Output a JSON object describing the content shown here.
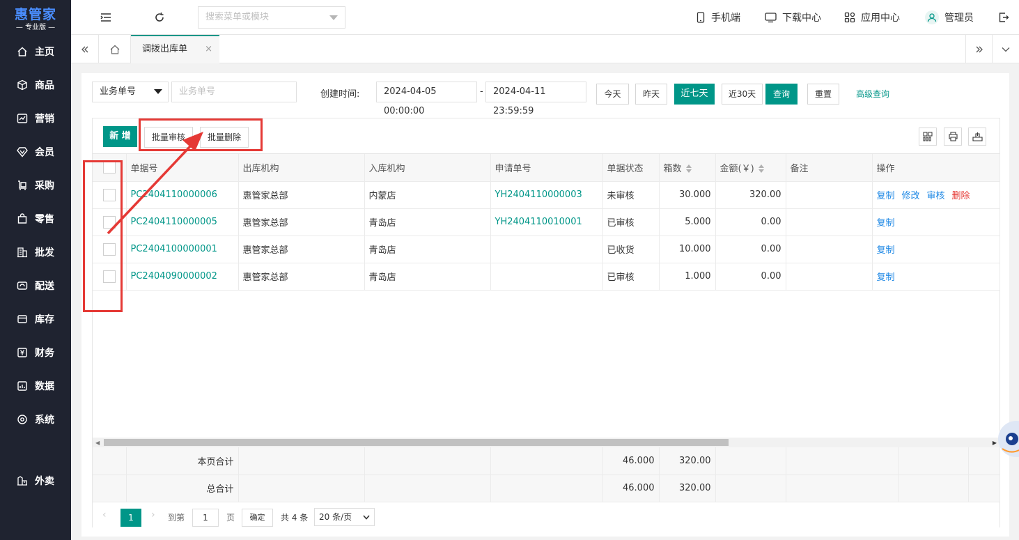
{
  "app": {
    "logo_main": "惠管家",
    "logo_sub": "— 专业版 —"
  },
  "sidebar": {
    "items": [
      {
        "label": "主页",
        "icon": "home-icon"
      },
      {
        "label": "商品",
        "icon": "box-icon"
      },
      {
        "label": "营销",
        "icon": "chart-icon"
      },
      {
        "label": "会员",
        "icon": "diamond-icon"
      },
      {
        "label": "采购",
        "icon": "purchase-icon"
      },
      {
        "label": "零售",
        "icon": "bag-icon"
      },
      {
        "label": "批发",
        "icon": "building-icon"
      },
      {
        "label": "配送",
        "icon": "delivery-icon"
      },
      {
        "label": "库存",
        "icon": "inventory-icon"
      },
      {
        "label": "财务",
        "icon": "yen-icon"
      },
      {
        "label": "数据",
        "icon": "data-icon"
      },
      {
        "label": "系统",
        "icon": "settings-icon"
      },
      {
        "label": "外卖",
        "icon": "takeout-icon"
      }
    ]
  },
  "topbar": {
    "search_placeholder": "搜索菜单或模块",
    "mobile": "手机端",
    "download": "下载中心",
    "apps": "应用中心",
    "user": "管理员"
  },
  "tabs": {
    "active": "调拨出库单",
    "close": "×"
  },
  "filter": {
    "type_select": "业务单号",
    "number_placeholder": "业务单号",
    "created_label": "创建时间:",
    "date_from": "2024-04-05 00:00:00",
    "date_sep": "-",
    "date_to": "2024-04-11 23:59:59",
    "today": "今天",
    "yesterday": "昨天",
    "last7": "近七天",
    "last30": "近30天",
    "query": "查询",
    "reset": "重置",
    "advanced": "高级查询"
  },
  "toolbar": {
    "add": "新 增",
    "batch_audit": "批量审核",
    "batch_delete": "批量删除"
  },
  "table": {
    "headers": {
      "no": "单据号",
      "out_org": "出库机构",
      "in_org": "入库机构",
      "apply_no": "申请单号",
      "status": "单据状态",
      "boxes": "箱数",
      "amount": "金额(￥)",
      "remark": "备注",
      "ops": "操作"
    },
    "rows": [
      {
        "no": "PC2404110000006",
        "out_org": "惠管家总部",
        "in_org": "内蒙店",
        "apply_no": "YH2404110000003",
        "status": "未审核",
        "boxes": "30.000",
        "amount": "320.00",
        "ops": [
          "复制",
          "修改",
          "审核",
          "删除"
        ]
      },
      {
        "no": "PC2404110000005",
        "out_org": "惠管家总部",
        "in_org": "青岛店",
        "apply_no": "YH2404110010001",
        "status": "已审核",
        "boxes": "5.000",
        "amount": "0.00",
        "ops": [
          "复制"
        ]
      },
      {
        "no": "PC2404100000001",
        "out_org": "惠管家总部",
        "in_org": "青岛店",
        "apply_no": "",
        "status": "已收货",
        "boxes": "10.000",
        "amount": "0.00",
        "ops": [
          "复制"
        ]
      },
      {
        "no": "PC2404090000002",
        "out_org": "惠管家总部",
        "in_org": "青岛店",
        "apply_no": "",
        "status": "已审核",
        "boxes": "1.000",
        "amount": "0.00",
        "ops": [
          "复制"
        ]
      }
    ],
    "page_total_label": "本页合计",
    "page_total_boxes": "46.000",
    "page_total_amount": "320.00",
    "grand_total_label": "总合计",
    "grand_total_boxes": "46.000",
    "grand_total_amount": "320.00"
  },
  "pager": {
    "current": "1",
    "goto": "到第",
    "page_input": "1",
    "page_unit": "页",
    "confirm": "确定",
    "total": "共 4 条",
    "page_size": "20 条/页"
  },
  "colors": {
    "accent": "#009688",
    "sidebar_bg": "#1f2330",
    "link": "#1e88e5",
    "danger": "#e53935"
  }
}
